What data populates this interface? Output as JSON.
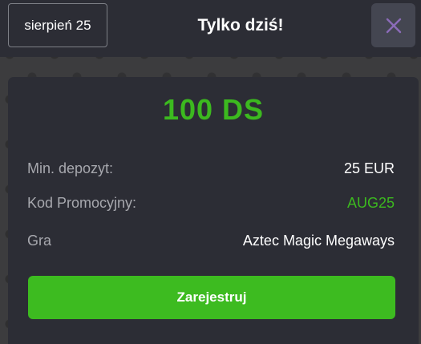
{
  "header": {
    "date_label": "sierpień 25",
    "title": "Tylko dziś!",
    "close_icon": "close-icon"
  },
  "offer": {
    "amount": "100 DS",
    "rows": [
      {
        "label": "Min. depozyt:",
        "value": "25 EUR"
      },
      {
        "label": "Kod Promocyjny:",
        "value": "AUG25"
      },
      {
        "label": "Gra",
        "value": "Aztec Magic Megaways"
      }
    ],
    "cta_label": "Zarejestruj"
  },
  "colors": {
    "accent_green": "#3cb91f",
    "panel_bg": "#2c2d35",
    "close_icon": "#8b6bb8"
  }
}
